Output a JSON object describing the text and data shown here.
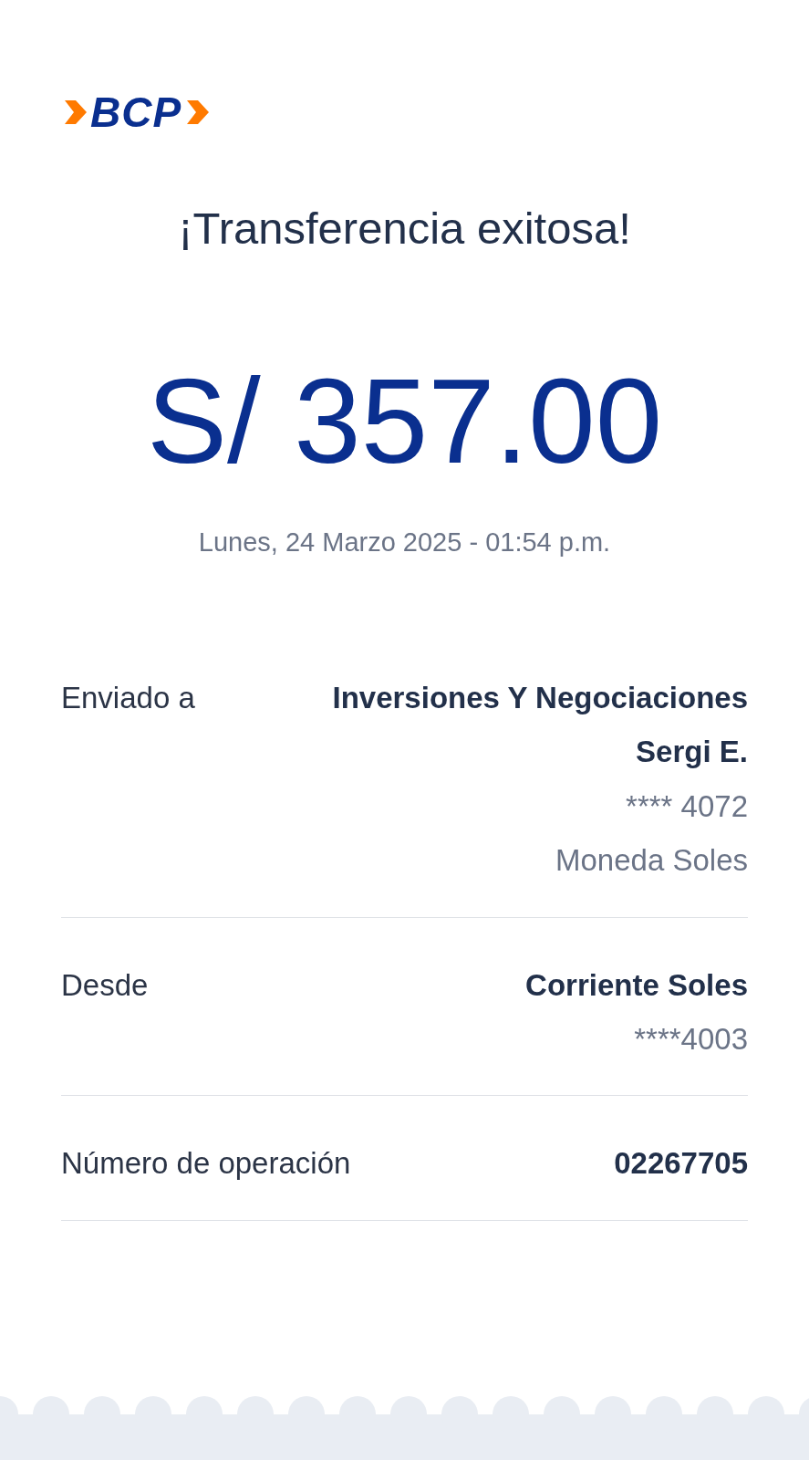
{
  "logo": {
    "text": "BCP"
  },
  "title": "¡Transferencia exitosa!",
  "amount": "S/ 357.00",
  "date": "Lunes, 24 Marzo 2025 - 01:54 p.m.",
  "details": [
    {
      "label": "Enviado a",
      "lines": [
        {
          "text": "Inversiones Y Negociaciones Sergi E.",
          "kind": "primary"
        },
        {
          "text": "**** 4072",
          "kind": "secondary"
        },
        {
          "text": "Moneda Soles",
          "kind": "secondary"
        }
      ]
    },
    {
      "label": "Desde",
      "lines": [
        {
          "text": "Corriente Soles",
          "kind": "primary"
        },
        {
          "text": "****4003",
          "kind": "secondary"
        }
      ]
    },
    {
      "label": "Número de operación",
      "lines": [
        {
          "text": "02267705",
          "kind": "primary"
        }
      ]
    }
  ]
}
